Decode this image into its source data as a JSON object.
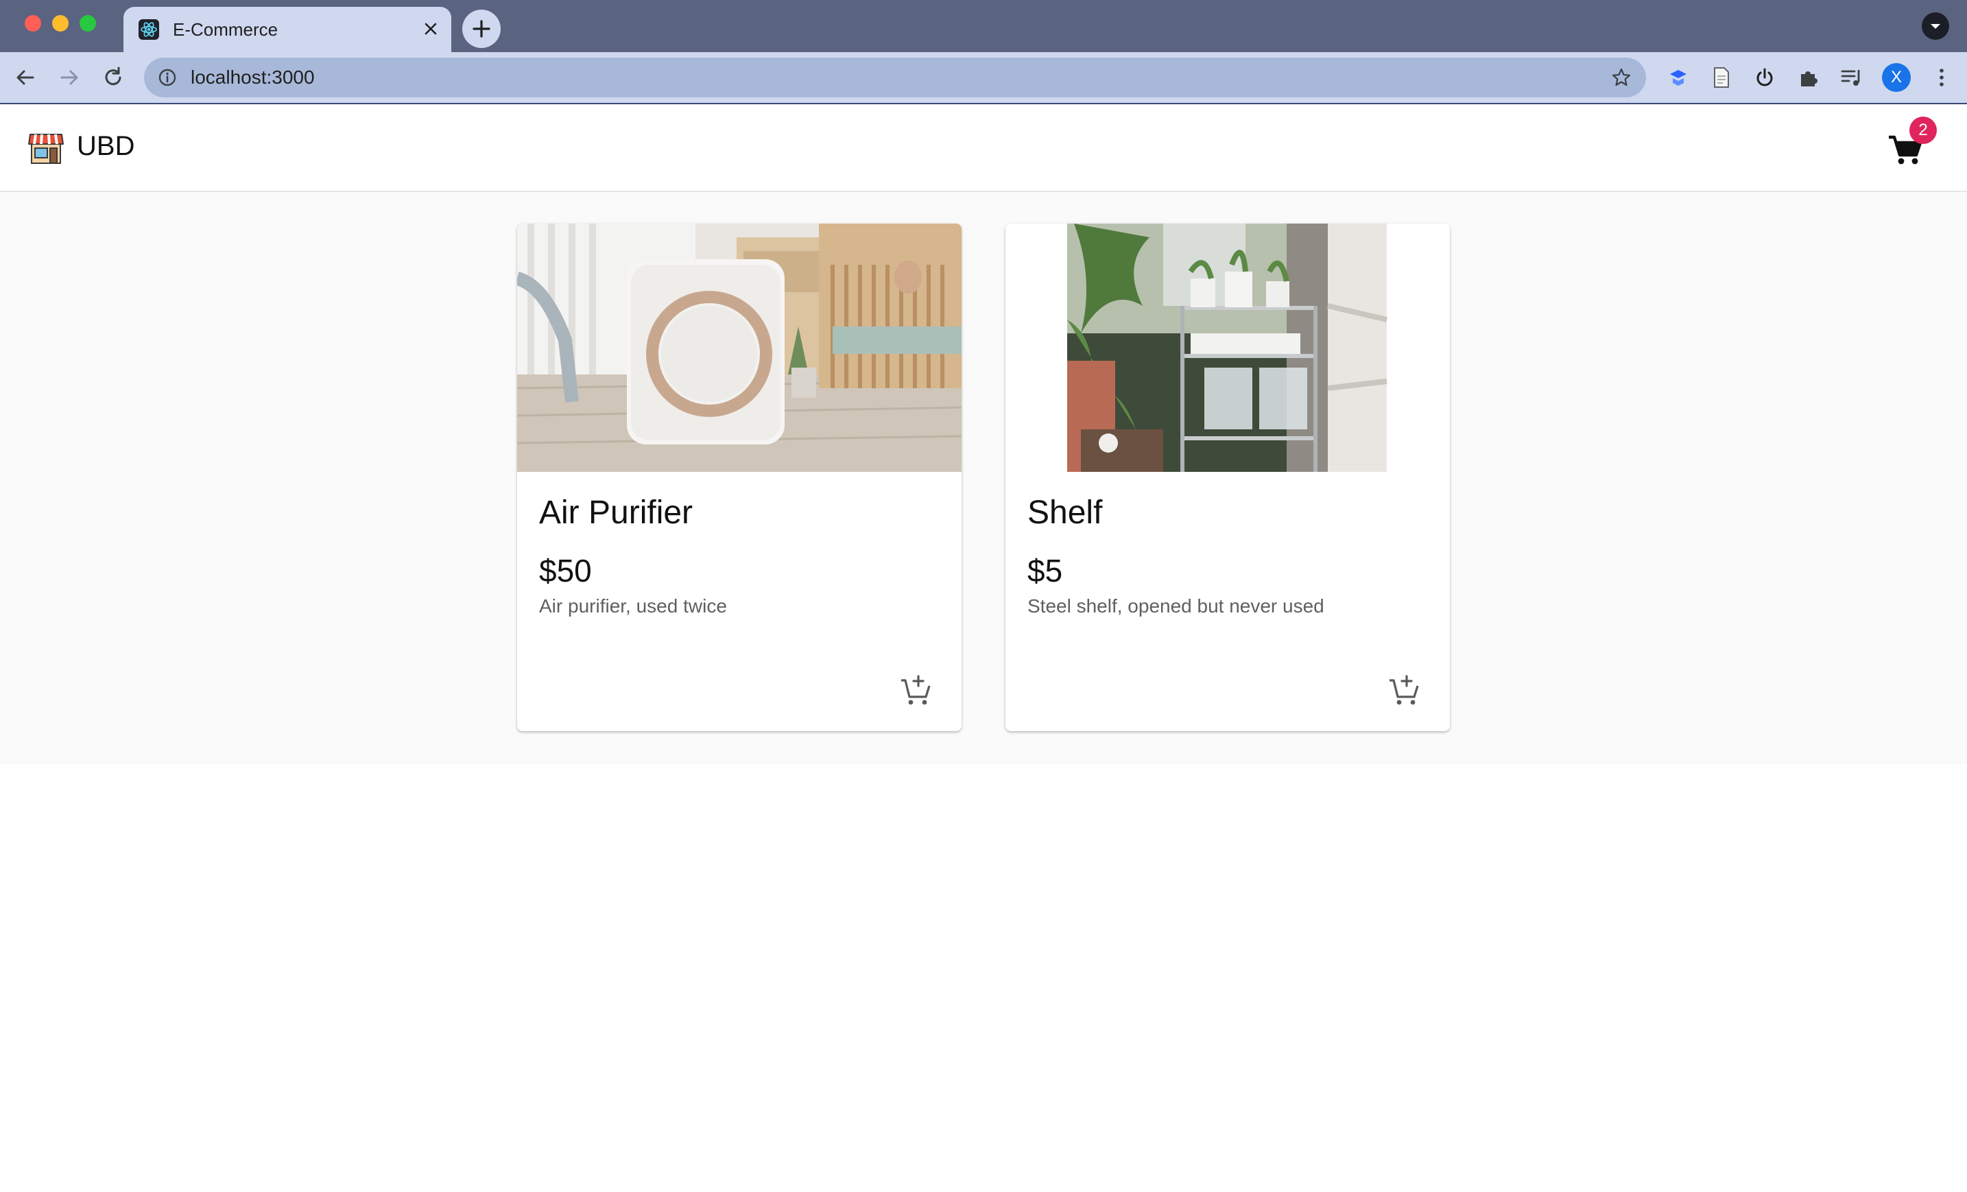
{
  "browser": {
    "tab_title": "E-Commerce",
    "url": "localhost:3000",
    "profile_initial": "X"
  },
  "app": {
    "brand": "UBD",
    "cart_count": "2"
  },
  "products": [
    {
      "name": "Air Purifier",
      "price": "$50",
      "description": "Air purifier, used twice"
    },
    {
      "name": "Shelf",
      "price": "$5",
      "description": "Steel shelf, opened but never used"
    }
  ],
  "colors": {
    "tabbar": "#5a6380",
    "toolbar": "#cfd8ef",
    "badge": "#e0245e",
    "page_bg": "#fafafa"
  }
}
